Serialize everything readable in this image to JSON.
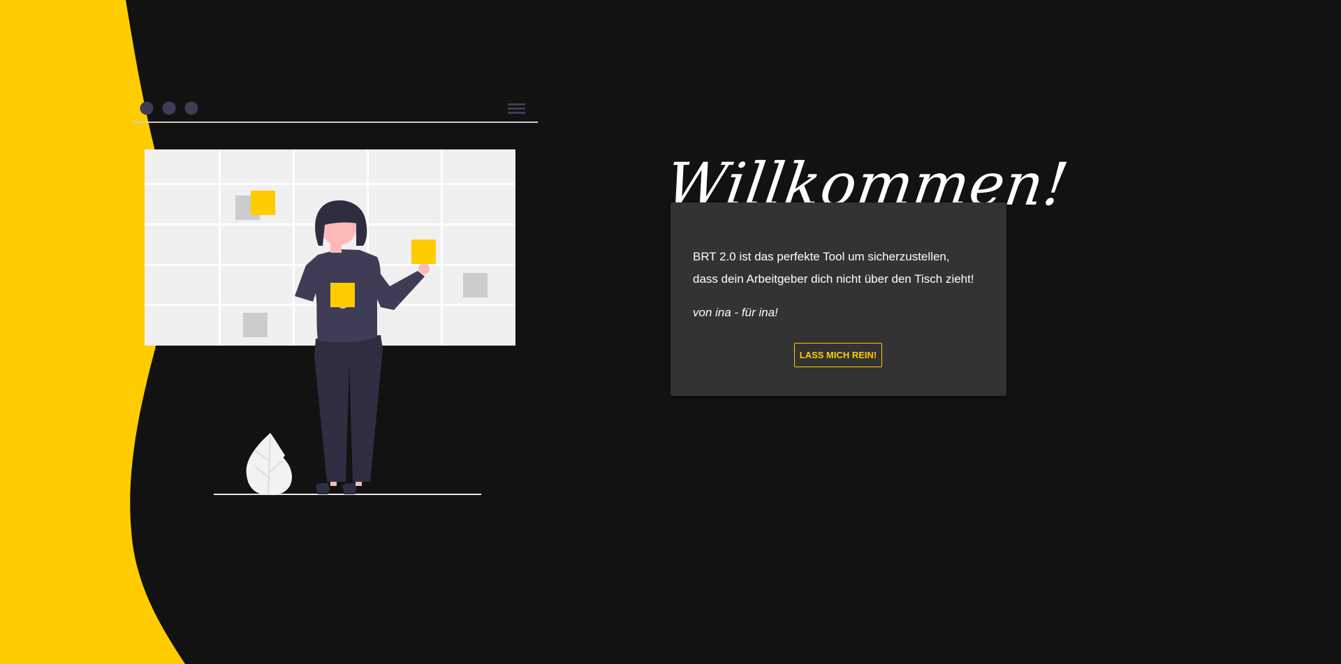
{
  "colors": {
    "background": "#121212",
    "accent": "#ffcc00",
    "card": "#333333",
    "figure_dark": "#2f2e41",
    "figure_shirt": "#3f3d56",
    "board": "#f0f0f0",
    "note_gray": "#cccccc"
  },
  "illustration": {
    "browser_dots": [
      "dot-icon",
      "dot-icon",
      "dot-icon"
    ],
    "menu_icon": "hamburger-menu-icon"
  },
  "welcome": {
    "title": "Willkommen!",
    "line1": "BRT 2.0 ist das perfekte Tool um sicherzustellen,",
    "line2": "dass dein Arbeitgeber dich nicht über den Tisch zieht!",
    "signature": "von ina - für ina!",
    "button_label": "LASS MICH REIN!"
  }
}
